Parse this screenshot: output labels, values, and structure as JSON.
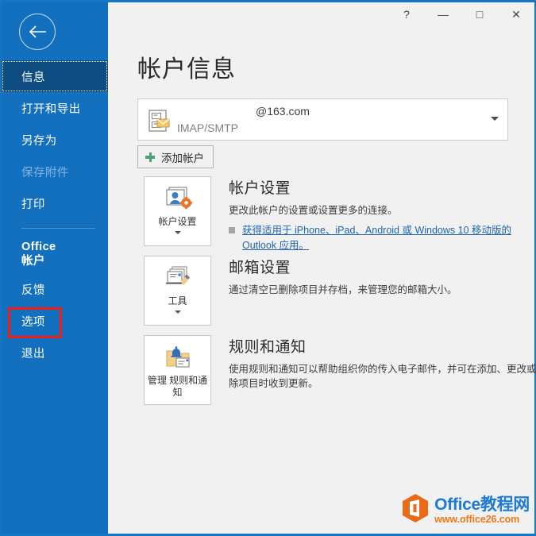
{
  "window": {
    "controls": [
      {
        "name": "help-button",
        "glyph": "?"
      },
      {
        "name": "minimize-button",
        "glyph": "—"
      },
      {
        "name": "maximize-button",
        "glyph": "□"
      },
      {
        "name": "close-button",
        "glyph": "✕"
      }
    ]
  },
  "sidebar": {
    "back_label": "back-arrow",
    "items": [
      {
        "label": "信息",
        "state": "selected"
      },
      {
        "label": "打开和导出",
        "state": "normal"
      },
      {
        "label": "另存为",
        "state": "normal"
      },
      {
        "label": "保存附件",
        "state": "disabled"
      },
      {
        "label": "打印",
        "state": "normal"
      },
      {
        "label": "Office 帐户",
        "state": "two-line"
      },
      {
        "label": "反馈",
        "state": "normal"
      },
      {
        "label": "选项",
        "state": "highlighted"
      },
      {
        "label": "退出",
        "state": "normal"
      }
    ],
    "highlight_color": "#f41c16",
    "background_color": "#1370bf",
    "selected_color": "#0d4d81"
  },
  "main": {
    "page_title": "帐户信息",
    "account": {
      "email": "@163.com",
      "type": "IMAP/SMTP",
      "icon": "mail-account-icon"
    },
    "add_account_label": "添加帐户",
    "sections": [
      {
        "button_label": "帐户设置",
        "button_icon": "account-settings-icon",
        "title": "帐户设置",
        "desc": "更改此帐户的设置或设置更多的连接。",
        "link": "获得适用于 iPhone、iPad、Android 或 Windows 10 移动版的 Outlook 应用。"
      },
      {
        "button_label": "工具",
        "button_icon": "mailbox-cleanup-tools-icon",
        "title": "邮箱设置",
        "desc": "通过清空已删除项目并存档，来管理您的邮箱大小。",
        "link": ""
      },
      {
        "button_label": "管理\n规则和通知",
        "button_icon": "rules-and-alerts-icon",
        "title": "规则和通知",
        "desc": "使用规则和通知可以帮助组织你的传入电子邮件，并可在添加、更改或删除项目时收到更新。",
        "link": ""
      }
    ]
  },
  "watermark": {
    "title": "Office教程网",
    "url": "www.office26.com",
    "title_color": "#1e7bd4",
    "url_color": "#f07818",
    "logo_color": "#ea6a17"
  }
}
